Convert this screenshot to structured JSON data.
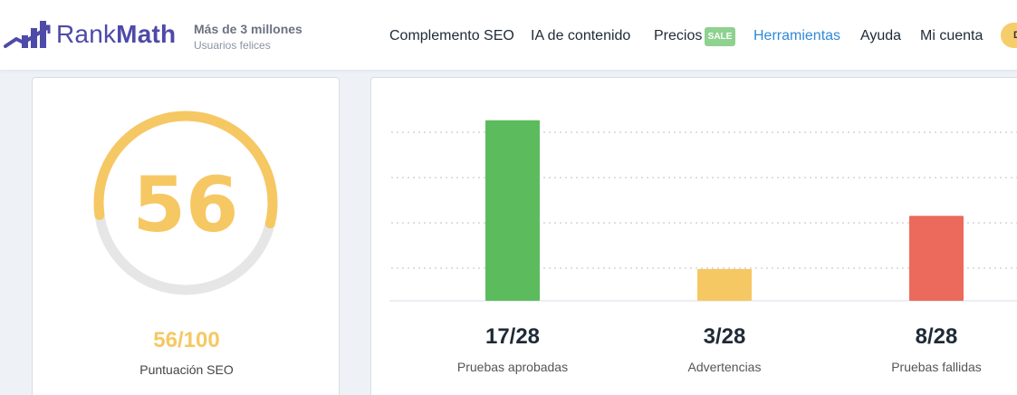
{
  "header": {
    "brand_prefix": "Rank",
    "brand_suffix": "Math",
    "tagline_main": "Más de 3 millones",
    "tagline_sub": "Usuarios felices",
    "nav": [
      {
        "label": "Complemento SEO"
      },
      {
        "label": "IA de contenido"
      },
      {
        "label": "Precios",
        "badge": "SALE"
      },
      {
        "label": "Herramientas",
        "active": true
      },
      {
        "label": "Ayuda"
      },
      {
        "label": "Mi cuenta"
      }
    ],
    "account_button_text": "D"
  },
  "score": {
    "value": "56",
    "ratio": "56/100",
    "label": "Puntuación SEO",
    "fraction": 0.56,
    "color": "#f6c863",
    "track_color": "#e6e6e6"
  },
  "chart_data": {
    "type": "bar",
    "categories": [
      "Pruebas aprobadas",
      "Advertencias",
      "Pruebas fallidas"
    ],
    "values": [
      17,
      3,
      8
    ],
    "value_labels": [
      "17/28",
      "3/28",
      "8/28"
    ],
    "ylim": [
      0,
      18
    ],
    "colors": [
      "#5cbb5c",
      "#f6c863",
      "#ec6a5c"
    ],
    "grid": true,
    "title": "",
    "xlabel": "",
    "ylabel": ""
  }
}
